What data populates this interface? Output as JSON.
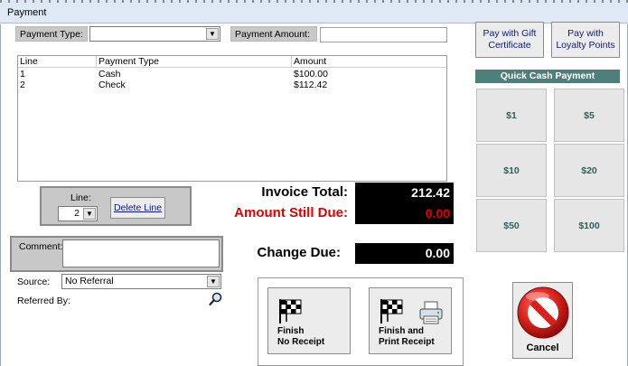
{
  "window": {
    "title": "Payment"
  },
  "payment_type": {
    "label": "Payment Type:",
    "value": ""
  },
  "payment_amount": {
    "label": "Payment Amount:",
    "value": ""
  },
  "list": {
    "headers": [
      "Line",
      "Payment Type",
      "Amount"
    ],
    "rows": [
      {
        "line": "1",
        "type": "Cash",
        "amount": "$100.00"
      },
      {
        "line": "2",
        "type": "Check",
        "amount": "$112.42"
      }
    ]
  },
  "line_select": {
    "label": "Line:",
    "value": "2"
  },
  "delete_line": {
    "label": "Delete Line"
  },
  "comment": {
    "label": "Comment:",
    "value": ""
  },
  "source": {
    "label": "Source:",
    "value": "No Referral"
  },
  "referred_by": {
    "label": "Referred By:"
  },
  "totals": {
    "invoice_total_label": "Invoice Total:",
    "invoice_total_value": "212.42",
    "amount_due_label": "Amount Still Due:",
    "amount_due_value": "0.00",
    "change_due_label": "Change Due:",
    "change_due_value": "0.00"
  },
  "actions": {
    "finish_no_receipt": "Finish\nNo Receipt",
    "finish_print_receipt": "Finish and\nPrint Receipt",
    "cancel": "Cancel"
  },
  "pay_buttons": {
    "gift_certificate": "Pay with Gift\nCertificate",
    "loyalty_points": "Pay with\nLoyalty Points"
  },
  "quick_cash": {
    "header": "Quick Cash Payment",
    "amounts": [
      "$1",
      "$5",
      "$10",
      "$20",
      "$50",
      "$100"
    ]
  },
  "icons": {
    "checkered_flag": "checkered-flag-icon",
    "printer": "printer-icon",
    "search": "magnifier-icon",
    "cancel": "no-entry-icon",
    "dropdown": "chevron-down-icon"
  },
  "colors": {
    "amount_due": "#e00000",
    "total_value_text": "#ffffff",
    "quick_cash_header": "#4d7f7d",
    "quick_cash_text": "#2f5f5d",
    "link_text": "#0a1a7a"
  }
}
